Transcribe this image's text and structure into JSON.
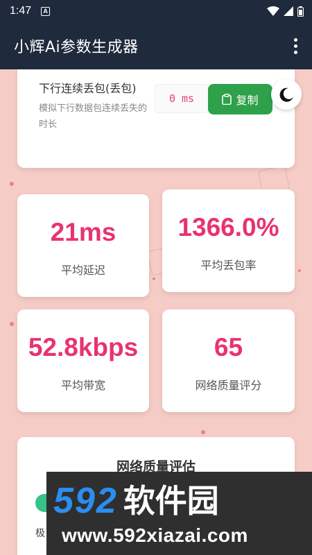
{
  "status_bar": {
    "time": "1:47",
    "badge": "A"
  },
  "app": {
    "title": "小辉Ai参数生成器"
  },
  "param": {
    "name": "下行连续丢包(丢包)",
    "description": "模拟下行数据包连续丢失的时长",
    "value": "0 ms",
    "copy_label": "复制"
  },
  "stats": [
    {
      "value": "21ms",
      "label": "平均延迟"
    },
    {
      "value": "1366.0%",
      "label": "平均丢包率"
    },
    {
      "value": "52.8kbps",
      "label": "平均带宽"
    },
    {
      "value": "65",
      "label": "网络质量评分"
    }
  ],
  "quality": {
    "title": "网络质量评估",
    "label_partial": "极"
  },
  "watermark": {
    "brand_num": "592",
    "brand_cn": "软件园",
    "url": "www.592xiazai.com"
  },
  "colors": {
    "accent": "#e8336e",
    "copy_button": "#2ea14a",
    "appbar": "#1f2a3c",
    "background": "#f6cdc6"
  }
}
